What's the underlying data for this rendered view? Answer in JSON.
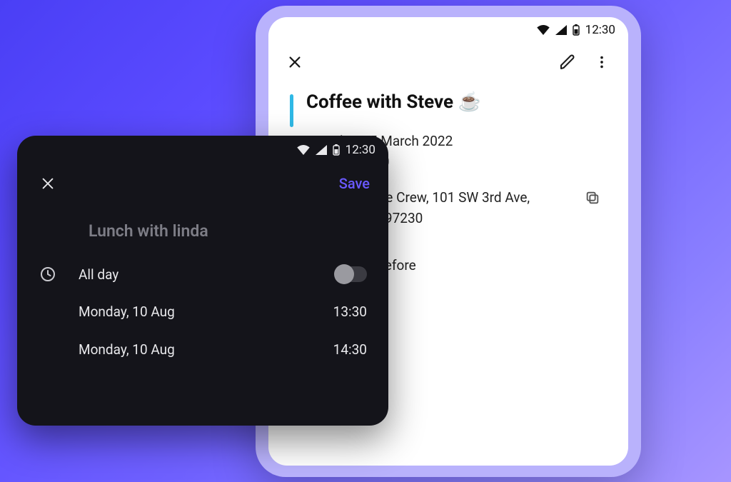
{
  "status": {
    "time": "12:30"
  },
  "light": {
    "event_title": "Coffee with Steve ☕",
    "date_line": "Tuesday, 15 March 2022",
    "time_line": "13:30 – 15:00",
    "address_line1": "District Coffee Crew, 101 SW 3rd Ave,",
    "address_line2": "Portland, OR 97230",
    "reminder": "15 minutes before"
  },
  "dark": {
    "save_label": "Save",
    "title": "Lunch with linda",
    "all_day_label": "All day",
    "start_date": "Monday, 10 Aug",
    "start_time": "13:30",
    "end_date": "Monday, 10 Aug",
    "end_time": "14:30"
  },
  "colors": {
    "accent_light": "#2fb9e6",
    "accent_dark": "#6a59ff"
  }
}
